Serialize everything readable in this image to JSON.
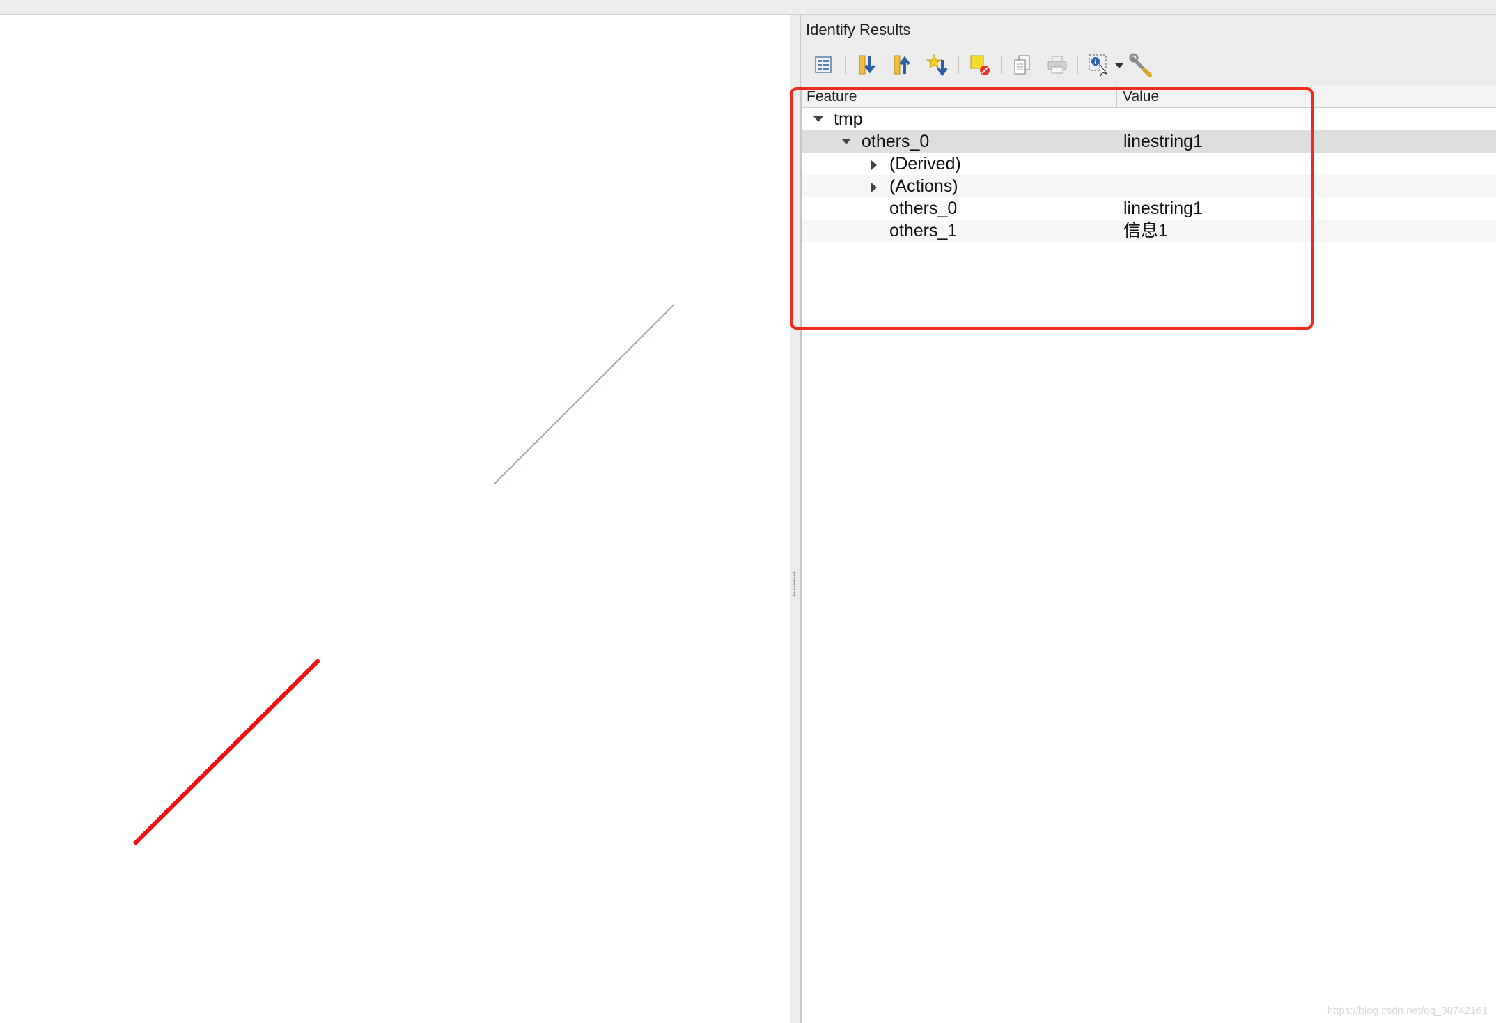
{
  "panel": {
    "title": "Identify Results",
    "toolbar": [
      {
        "icon": "expand-tree-icon"
      },
      {
        "icon": "expand-all-icon"
      },
      {
        "icon": "collapse-all-icon"
      },
      {
        "icon": "expand-new-results-icon"
      },
      {
        "icon": "clear-highlights-icon"
      },
      {
        "icon": "copy-feature-icon"
      },
      {
        "icon": "print-icon"
      },
      {
        "icon": "identify-mode-icon"
      },
      {
        "icon": "dropdown-arrow-icon"
      },
      {
        "icon": "settings-wrench-icon"
      }
    ]
  },
  "tree": {
    "columns": {
      "feature": "Feature",
      "value": "Value"
    },
    "rows": [
      {
        "feature": "tmp",
        "value": "",
        "expander": "expanded"
      },
      {
        "feature": "others_0",
        "value": "linestring1",
        "expander": "expanded",
        "selected": true
      },
      {
        "feature": "(Derived)",
        "value": "",
        "expander": "collapsed"
      },
      {
        "feature": "(Actions)",
        "value": "",
        "expander": "collapsed"
      },
      {
        "feature": "others_0",
        "value": "linestring1",
        "expander": "none"
      },
      {
        "feature": "others_1",
        "value": "信息1",
        "expander": "none"
      }
    ]
  },
  "map": {
    "features": [
      {
        "name": "selected-line",
        "color": "#ee1111"
      },
      {
        "name": "other-line",
        "color": "#b0a99a"
      }
    ]
  },
  "annotation": {
    "highlight_color": "#ee2b1c"
  },
  "watermark": "https://blog.csdn.net/qq_38742161"
}
